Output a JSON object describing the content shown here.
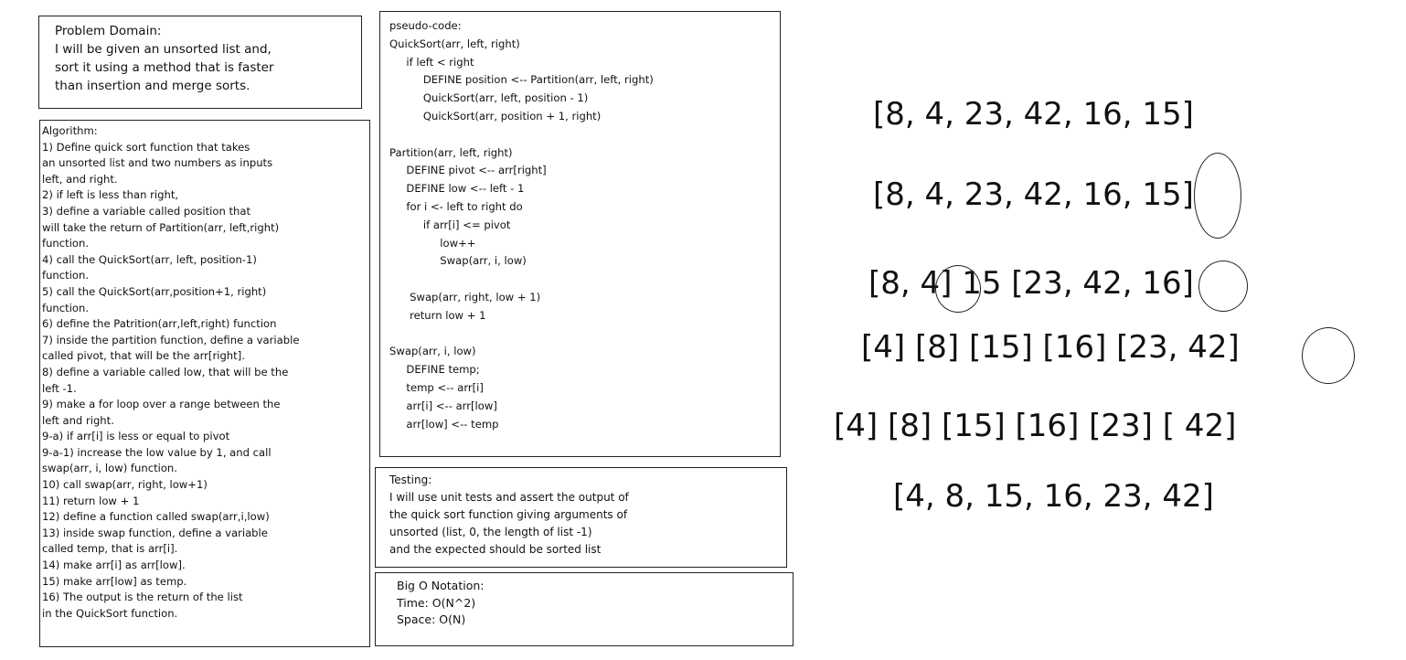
{
  "problem_domain": {
    "lines": [
      "Problem Domain:",
      "I will be given an unsorted list and,",
      "sort it using a method that is faster",
      "than insertion and merge sorts."
    ]
  },
  "algorithm": {
    "lines": [
      "Algorithm:",
      "1) Define quick sort function that takes",
      "an unsorted list and two numbers as inputs",
      "left, and right.",
      "2) if left is less than right,",
      "3) define a variable called position that",
      "will take the return of Partition(arr, left,right)",
      "function.",
      "4) call the QuickSort(arr, left, position-1)",
      "function.",
      "5) call the QuickSort(arr,position+1, right)",
      "function.",
      "6) define the Patrition(arr,left,right) function",
      "7) inside the partition function, define a variable",
      "called pivot, that will be the arr[right].",
      "8) define a variable called low, that will be the",
      "left -1.",
      "9) make a for loop over a range between the",
      "left and right.",
      "9-a) if arr[i] is less or equal to pivot",
      "9-a-1) increase the low value by 1, and call",
      "swap(arr, i, low) function.",
      "10) call swap(arr, right, low+1)",
      "11) return low + 1",
      "12) define a function called swap(arr,i,low)",
      "13) inside swap function, define a variable",
      "called temp, that is arr[i].",
      "14) make arr[i] as arr[low].",
      "15) make arr[low] as temp.",
      "16) The output is the return of the list",
      "in the QuickSort function."
    ]
  },
  "pseudo_code": {
    "lines": [
      "pseudo-code:",
      "QuickSort(arr, left, right)",
      "     if left < right",
      "          DEFINE position <-- Partition(arr, left, right)",
      "          QuickSort(arr, left, position - 1)",
      "          QuickSort(arr, position + 1, right)",
      "",
      "Partition(arr, left, right)",
      "     DEFINE pivot <-- arr[right]",
      "     DEFINE low <-- left - 1",
      "     for i <- left to right do",
      "          if arr[i] <= pivot",
      "               low++",
      "               Swap(arr, i, low)",
      "",
      "      Swap(arr, right, low + 1)",
      "      return low + 1",
      "",
      "Swap(arr, i, low)",
      "     DEFINE temp;",
      "     temp <-- arr[i]",
      "     arr[i] <-- arr[low]",
      "     arr[low] <-- temp"
    ]
  },
  "testing": {
    "lines": [
      "Testing:",
      "I will use unit tests and assert the output of",
      "the quick sort function giving arguments of",
      "unsorted (list, 0, the length of list -1)",
      "and the expected should be sorted list"
    ]
  },
  "big_o": {
    "lines": [
      "Big O Notation:",
      "Time: O(N^2)",
      "Space: O(N)"
    ]
  },
  "walkthrough": {
    "rows": [
      "[8, 4, 23, 42, 16, 15]",
      "[8, 4, 23, 42, 16, 15]",
      "[8, 4] 15 [23, 42, 16]",
      "[4] [8] [15] [16] [23, 42]",
      "[4] [8] [15] [16] [23] [ 42]",
      "[4, 8, 15, 16, 23, 42]"
    ]
  }
}
